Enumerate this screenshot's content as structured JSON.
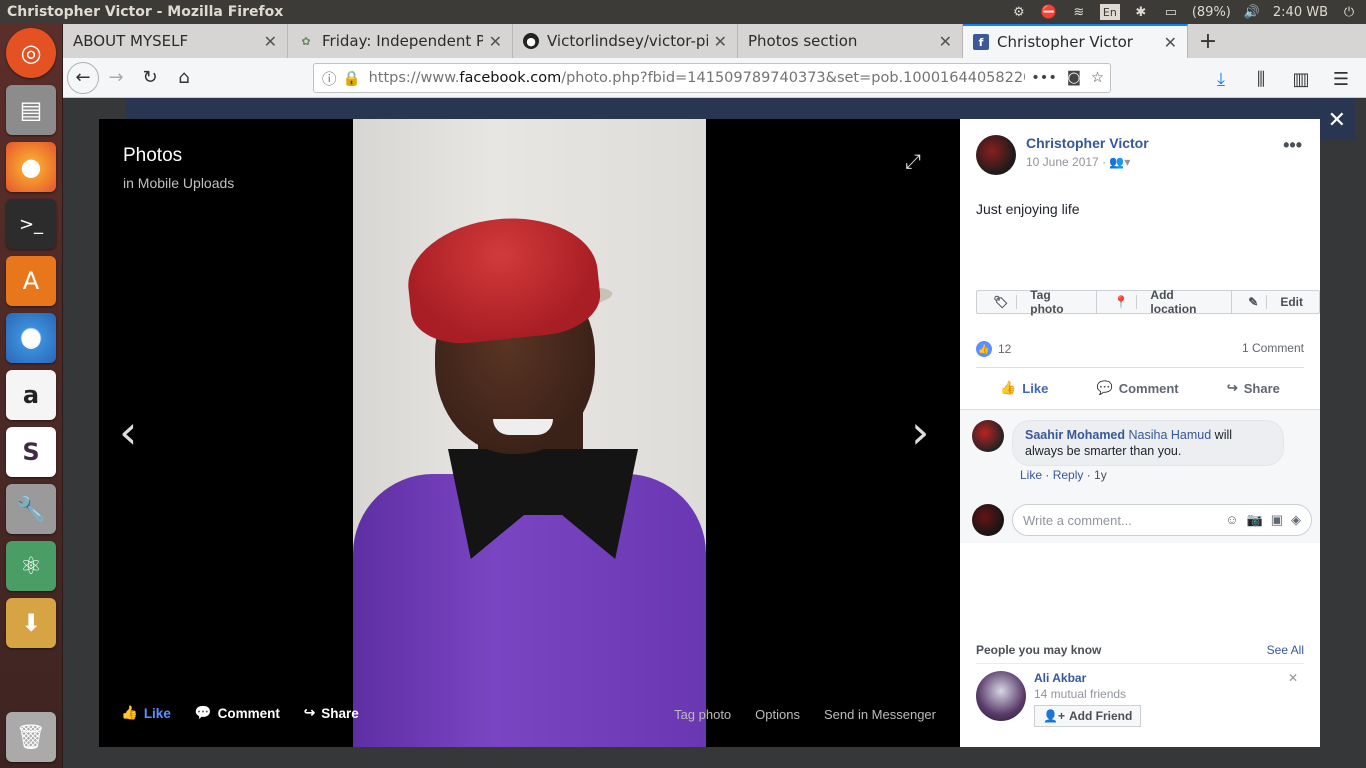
{
  "window": {
    "title": "Christopher Victor - Mozilla Firefox"
  },
  "tray": {
    "language": "En",
    "battery": "(89%)",
    "time": "2:40 WB"
  },
  "tabs": [
    {
      "label": "ABOUT MYSELF",
      "favicon": "none",
      "active": false
    },
    {
      "label": "Friday: Independent Pro",
      "favicon": "seedling-icon",
      "active": false
    },
    {
      "label": "Victorlindsey/victor-pig",
      "favicon": "github-icon",
      "active": false
    },
    {
      "label": "Photos section",
      "favicon": "none",
      "active": false
    },
    {
      "label": "Christopher Victor",
      "favicon": "facebook-icon",
      "active": true
    }
  ],
  "url": {
    "prefix": "https://www.",
    "host": "facebook.com",
    "path": "/photo.php?fbid=141509789740373&set=pob.100016440582207&"
  },
  "viewer": {
    "title": "Photos",
    "subtitle": "in Mobile Uploads",
    "actions": {
      "like": "Like",
      "comment": "Comment",
      "share": "Share"
    },
    "links": {
      "tag": "Tag photo",
      "options": "Options",
      "send": "Send in Messenger"
    }
  },
  "post": {
    "author": "Christopher Victor",
    "date": "10 June 2017 ·",
    "caption": "Just enjoying life",
    "tag_photo": "Tag photo",
    "add_location": "Add location",
    "edit": "Edit",
    "likes": "12",
    "comments_count": "1 Comment",
    "like": "Like",
    "comment": "Comment",
    "share": "Share"
  },
  "comment": {
    "name": "Saahir Mohamed",
    "tagged": "Nasiha Hamud",
    "text": " will always be smarter than you.",
    "like": "Like",
    "reply": "Reply",
    "age": "1y"
  },
  "write": {
    "placeholder": "Write a comment..."
  },
  "pymk": {
    "title": "People you may know",
    "see_all": "See All",
    "name": "Ali Akbar",
    "mutual": "14 mutual friends",
    "add": "Add Friend"
  }
}
